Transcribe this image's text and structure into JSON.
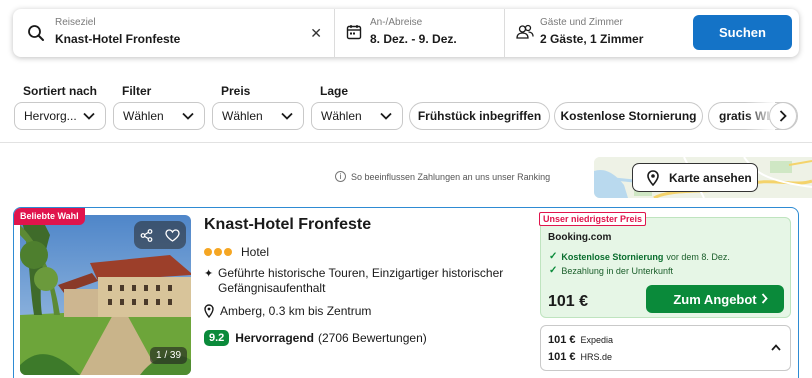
{
  "search": {
    "destination_label": "Reiseziel",
    "destination_value": "Knast-Hotel Fronfeste",
    "dates_label": "An-/Abreise",
    "dates_value": "8. Dez. - 9. Dez.",
    "guests_label": "Gäste und Zimmer",
    "guests_value": "2 Gäste, 1 Zimmer",
    "clear_glyph": "✕",
    "submit_label": "Suchen"
  },
  "filters": {
    "sort": {
      "label": "Sortiert nach",
      "value": "Hervorg..."
    },
    "filter": {
      "label": "Filter",
      "value": "Wählen"
    },
    "price": {
      "label": "Preis",
      "value": "Wählen"
    },
    "location": {
      "label": "Lage",
      "value": "Wählen"
    },
    "quick": [
      "Frühstück inbegriffen",
      "Kostenlose Stornierung",
      "gratis WLAN"
    ]
  },
  "ranking_info": "So beeinflussen Zahlungen an uns unser Ranking",
  "map_button": "Karte ansehen",
  "hotel": {
    "badge": "Beliebte Wahl",
    "name": "Knast-Hotel Fronfeste",
    "stars": 3,
    "type": "Hotel",
    "features": "Geführte historische Touren, Einzigartiger historischer Gefängnisaufenthalt",
    "location": "Amberg, 0.3 km bis Zentrum",
    "score": "9.2",
    "score_label": "Hervorragend",
    "reviews": "(2706 Bewertungen)",
    "photo_count": "1 / 39"
  },
  "deal": {
    "badge": "Unser niedrigster Preis",
    "provider": "Booking.com",
    "perk1_strong": "Kostenlose Stornierung",
    "perk1_rest": "vor dem 8. Dez.",
    "perk2": "Bezahlung in der Unterkunft",
    "price": "101 €",
    "cta": "Zum Angebot"
  },
  "other_offers": [
    {
      "price": "101 €",
      "provider": "Expedia"
    },
    {
      "price": "101 €",
      "provider": "HRS.de"
    }
  ],
  "colors": {
    "primary_blue": "#1473c7",
    "deal_green": "#0a8a3a",
    "badge_red": "#e0144c",
    "star_orange": "#f5a623"
  }
}
